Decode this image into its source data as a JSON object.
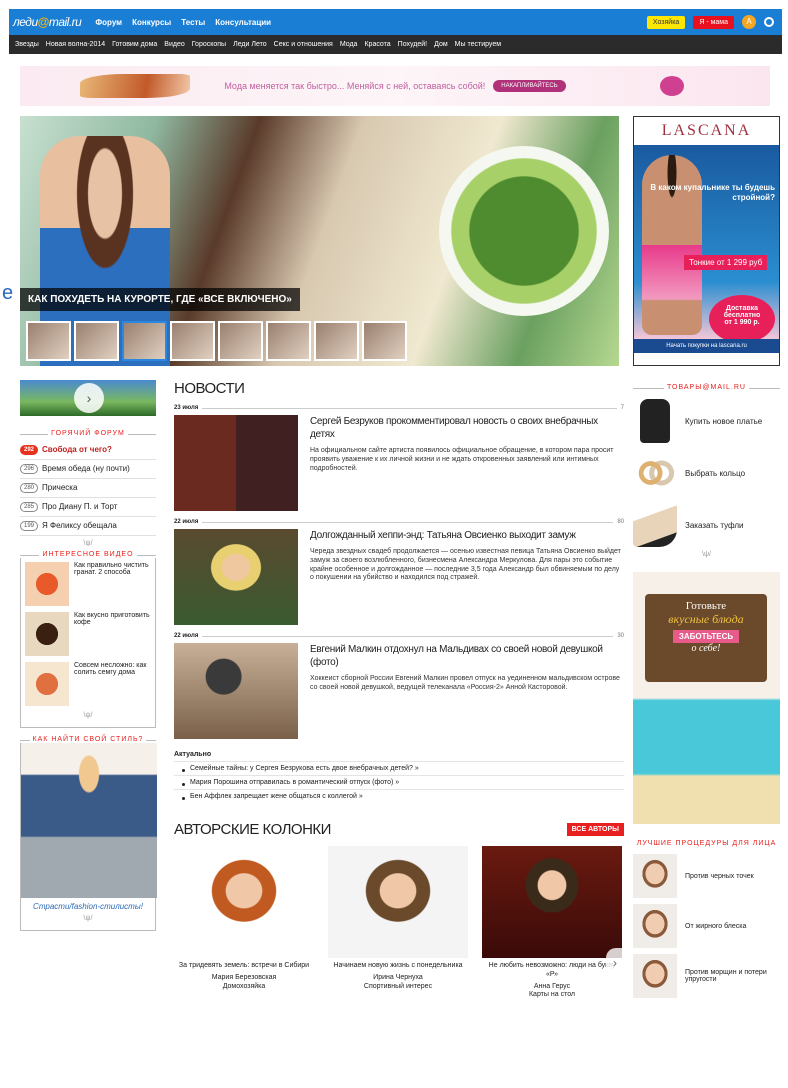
{
  "topbar": {
    "logo_main": "леди",
    "logo_accent": "@",
    "logo_rest": "mail.ru",
    "nav": [
      "Форум",
      "Конкурсы",
      "Тесты",
      "Консультации"
    ],
    "btn_hostess": "Хозяйка",
    "btn_mom": "Я - мама",
    "avatar_letter": "A"
  },
  "catbar": [
    "Звезды",
    "Новая волна-2014",
    "Готовим дома",
    "Видео",
    "Гороскопы",
    "Леди Лето",
    "Секс и отношения",
    "Мода",
    "Красота",
    "Похудей!",
    "Дом",
    "Мы тестируем"
  ],
  "banner": {
    "text": "Мода меняется так быстро... Меняйся с ней, оставаясь собой!",
    "button": "НАКАПЛИВАЙТЕСЬ"
  },
  "hero": {
    "title": "КАК ПОХУДЕТЬ НА КУРОРТЕ, ГДЕ «ВСЕ ВКЛЮЧЕНО»",
    "thumbs": 9,
    "selected_thumb": 3
  },
  "lascana": {
    "logo": "LASCANA",
    "question": "В каком купальнике ты будешь стройной?",
    "price": "Тонкие от 1 299 руб",
    "delivery": "Доставка бесплатно",
    "delivery_note": "от 1 990 р.",
    "cta": "Начать покупки на lascana.ru"
  },
  "left": {
    "forum_header": "ГОРЯЧИЙ ФОРУМ",
    "forum": [
      {
        "count": "292",
        "text": "Свобода от чего?",
        "hot": true
      },
      {
        "count": "296",
        "text": "Время обеда (ну почти)",
        "hot": false
      },
      {
        "count": "280",
        "text": "Прическа",
        "hot": false
      },
      {
        "count": "285",
        "text": "Про Диану П. и Торт",
        "hot": false
      },
      {
        "count": "199",
        "text": "Я Феликсу обещала",
        "hot": false
      }
    ],
    "video_header": "ИНТЕРЕСНОЕ ВИДЕО",
    "videos": [
      "Как правильно чистить гранат. 2 способа",
      "Как вкусно приготовить кофе",
      "Совсем несложно: как солить семгу дома"
    ],
    "style_header": "КАК НАЙТИ СВОЙ СТИЛЬ?",
    "style_link": "Страсти/fashion-стилисты!",
    "sig": "\\ψ/"
  },
  "news": {
    "header": "НОВОСТИ",
    "items": [
      {
        "date": "23 июля",
        "comments": "7",
        "title": "Сергей Безруков прокомментировал новость о своих внебрачных детях",
        "text": "На официальном сайте артиста появилось официальное обращение, в котором пара просит проявить уважение к их личной жизни и не ждать откровенных заявлений или интимных подробностей."
      },
      {
        "date": "22 июля",
        "comments": "80",
        "title": "Долгожданный хеппи-энд: Татьяна Овсиенко выходит замуж",
        "text": "Череда звездных свадеб продолжается — осенью известная певица Татьяна Овсиенко выйдет замуж за своего возлюбленного, бизнесмена Александра Меркулова. Для пары это событие крайне особенное и долгожданное — последние 3,5 года Александр был обвиняемым по делу о покушении на убийство и находился под стражей."
      },
      {
        "date": "22 июля",
        "comments": "30",
        "title": "Евгений Малкин отдохнул на Мальдивах со своей новой девушкой (фото)",
        "text": "Хоккеист сборной России Евгений Малкин провел отпуск на уединенном мальдивском острове со своей новой девушкой, ведущей телеканала «Россия-2» Анной Касторовой."
      }
    ],
    "actual_header": "Актуально",
    "actual": [
      "Семейные тайны: у Сергея Безрукова есть двое внебрачных детей? »",
      "Мария Порошина отправилась в романтический отпуск (фото) »",
      "Бен Аффлек запрещает жене общаться с коллегой »"
    ]
  },
  "columns": {
    "header": "АВТОРСКИЕ КОЛОНКИ",
    "all_btn": "ВСЕ АВТОРЫ",
    "authors": [
      {
        "title": "За тридевять земель: встречи в Сибири",
        "name": "Мария Березовская",
        "role": "Домохозяйка"
      },
      {
        "title": "Начинаем новую жизнь с понедельника",
        "name": "Ирина Чернуха",
        "role": "Спортивный интерес"
      },
      {
        "title": "Не любить невозможно: люди на букву «Р»",
        "name": "Анна Герус",
        "role": "Карты на стол"
      }
    ]
  },
  "right": {
    "goods_header": "ТОВАРЫ@MAIL.RU",
    "goods": [
      "Купить новое платье",
      "Выбрать кольцо",
      "Заказать туфли"
    ],
    "food_ad": {
      "t1": "Готовьте",
      "t2": "вкусные блюда",
      "t3": "ЗАБОТЬТЕСЬ",
      "t4": "о себе!"
    },
    "proc_header": "ЛУЧШИЕ ПРОЦЕДУРЫ ДЛЯ ЛИЦА",
    "procedures": [
      "Против черных точек",
      "От жирного блеска",
      "Против морщин и потери упругости"
    ]
  },
  "edge_letter": "e",
  "scroll_arrow": "›",
  "promo_arrow": "›",
  "colors": {
    "topbar": "#1a7fd4",
    "accent": "#e8201e",
    "catbar": "#2b2b2b"
  }
}
